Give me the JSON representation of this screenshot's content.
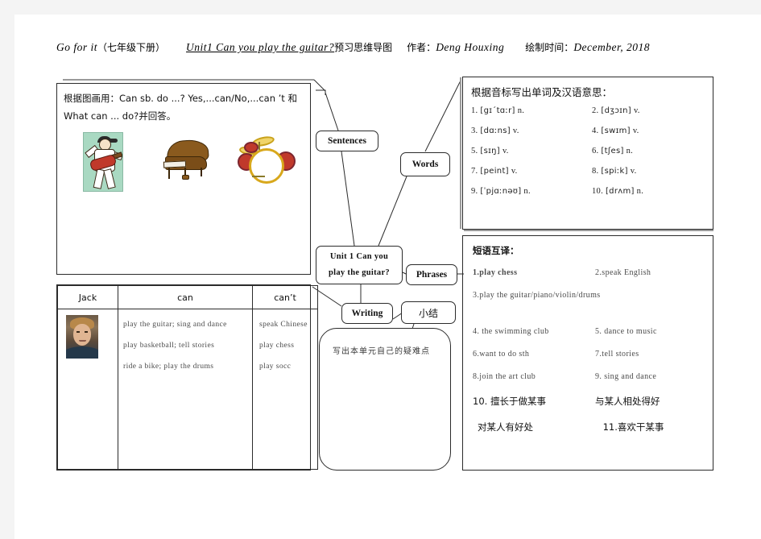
{
  "header": {
    "book": "Go for it",
    "book_cn": "（七年级下册）",
    "unit_title": "Unit1 Can you play the guitar?",
    "map_label": "预习思维导图",
    "author_label": "作者：",
    "author": "Deng Houxing",
    "date_label": "绘制时间：",
    "date": "December, 2018"
  },
  "picture_box": {
    "prompt_line1_cn": "根据图画用：",
    "prompt_line1_en": "Can  sb.  do  ...?  Yes,...can/No,...can ’t",
    "prompt_and": "和",
    "prompt_line2_en": "What can ... do?",
    "prompt_line2_cn": "并回答。",
    "images": [
      "guitarist-clipart",
      "piano-clipart",
      "drums-clipart"
    ]
  },
  "jack_table": {
    "headers": [
      "Jack",
      "can",
      "can’t"
    ],
    "photo": "jack-portrait-photo",
    "can": [
      "play  the  guitar;  sing  and  dance",
      "play  basketball;  tell  stories",
      "ride  a  bike;  play  the  drums"
    ],
    "cant": [
      "speak  Chinese",
      "play  chess",
      "play  socc"
    ]
  },
  "words_box": {
    "title": "根据音标写出单词及汉语意思：",
    "items": [
      {
        "num": "1.",
        "ipa": "[gɪˊtɑːr]",
        "pos": "n."
      },
      {
        "num": "2.",
        "ipa": "[dʒɔɪn]",
        "pos": "v."
      },
      {
        "num": "3.",
        "ipa": "[dɑːns]",
        "pos": "v."
      },
      {
        "num": "4.",
        "ipa": "[swɪm]",
        "pos": "v."
      },
      {
        "num": "5.",
        "ipa": "[sɪŋ]",
        "pos": "v."
      },
      {
        "num": "6.",
        "ipa": "[tʃes]",
        "pos": "n."
      },
      {
        "num": "7.",
        "ipa": "[peint]",
        "pos": "v."
      },
      {
        "num": "8.",
        "ipa": "[spiːk]",
        "pos": "v."
      },
      {
        "num": "9.",
        "ipa": "[ˈpjɑːnəʊ]",
        "pos": "n."
      },
      {
        "num": "10.",
        "ipa": "[drʌm]",
        "pos": "n."
      }
    ]
  },
  "phrases_box": {
    "title": "短语互译：",
    "rows": [
      {
        "left": "1.play  chess",
        "right": "2.speak  English",
        "first_bold": true
      },
      {
        "left": "3.play  the  guitar/piano/violin/drums",
        "right": "",
        "full": true
      },
      {
        "left": "4.  the  swimming  club",
        "right": "5. dance  to  music",
        "underline_right_word": "to"
      },
      {
        "left": "6.want  to  do  sth",
        "right": "7.tell  stories"
      },
      {
        "left": "8.join  the  art  club",
        "right": "9.  sing  and  dance"
      }
    ],
    "cn_rows": [
      {
        "left": "10.  擅长于做某事",
        "right": "与某人相处得好"
      },
      {
        "left": "对某人有好处",
        "right": "11.喜欢干某事"
      }
    ]
  },
  "mindmap": {
    "sentences": "Sentences",
    "words": "Words",
    "center_line1": "Unit  1  Can  you",
    "center_line2": "play  the  guitar?",
    "phrases": "Phrases",
    "writing": "Writing",
    "summary": "小结",
    "notes_prompt": "写出本单元自己的疑难点"
  }
}
